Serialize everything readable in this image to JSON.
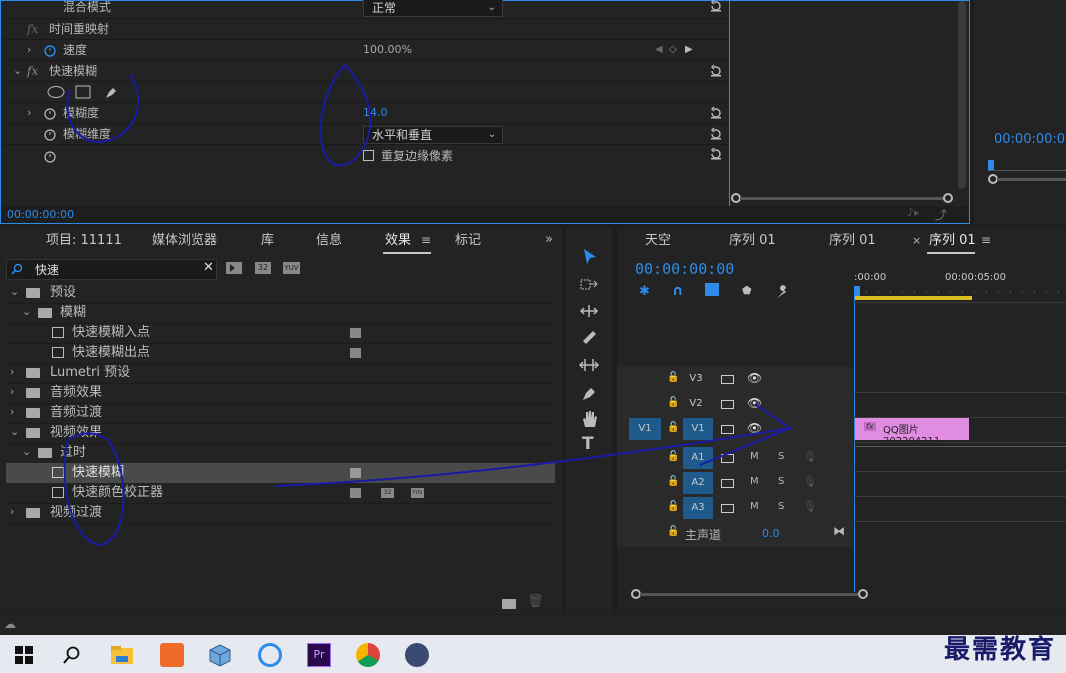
{
  "effect_controls": {
    "rows": [
      {
        "label": "混合模式",
        "value": "正常"
      },
      {
        "label": "时间重映射"
      },
      {
        "label": "速度",
        "value": "100.00%"
      },
      {
        "label": "快速模糊"
      },
      {
        "label": "模糊度",
        "value": "14.0"
      },
      {
        "label": "模糊维度",
        "value": "水平和垂直"
      },
      {
        "label": "重复边缘像素"
      }
    ],
    "fx_label": "fx",
    "timecode": "00:00:00:00"
  },
  "program_monitor": {
    "timecode": "00:00:00:00"
  },
  "project_panel": {
    "tabs": [
      "项目: 11111",
      "媒体浏览器",
      "库",
      "信息",
      "效果",
      "标记"
    ],
    "active_tab": "效果",
    "search_value": "快速",
    "badges": [
      "32",
      "YUV"
    ],
    "tree": [
      {
        "label": "预设"
      },
      {
        "label": "模糊"
      },
      {
        "label": "快速模糊入点"
      },
      {
        "label": "快速模糊出点"
      },
      {
        "label": "Lumetri 预设"
      },
      {
        "label": "音频效果"
      },
      {
        "label": "音频过渡"
      },
      {
        "label": "视频效果"
      },
      {
        "label": "过时"
      },
      {
        "label": "快速模糊"
      },
      {
        "label": "快速颜色校正器"
      },
      {
        "label": "视频过渡"
      }
    ]
  },
  "tools_panel": {
    "tools": [
      "selection",
      "track-select",
      "ripple",
      "razor",
      "slip",
      "pen",
      "hand",
      "type"
    ]
  },
  "timeline": {
    "tabs": [
      "天空",
      "序列 01",
      "序列 01",
      "序列 01"
    ],
    "active_tab_index": 3,
    "timecode": "00:00:00:00",
    "ruler_labels": [
      ":00:00",
      "00:00:05:00"
    ],
    "tracks": [
      {
        "name": "V3"
      },
      {
        "name": "V2"
      },
      {
        "name": "V1",
        "source": "V1"
      },
      {
        "name": "A1"
      },
      {
        "name": "A2"
      },
      {
        "name": "A3"
      }
    ],
    "master_label": "主声道",
    "master_value": "0.0",
    "mute_label": "M",
    "solo_label": "S",
    "clip_fx": "fx",
    "clip_name": "QQ图片202204211"
  },
  "watermark": "最需教育",
  "colors": {
    "accent": "#2d8ceb",
    "clip": "#e08ce0",
    "annotation": "#1a1aa8"
  }
}
